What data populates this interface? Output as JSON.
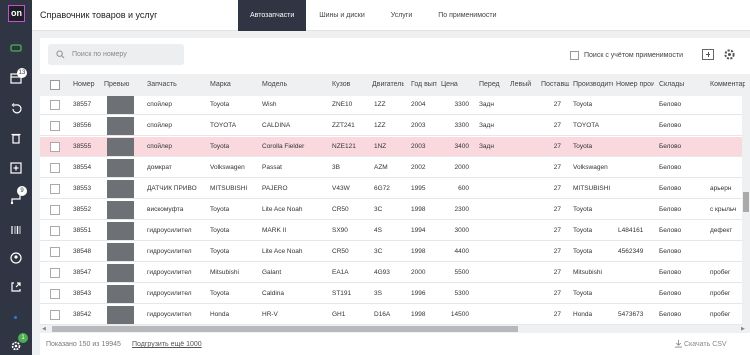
{
  "app": {
    "logo": "on",
    "title": "Справочник товаров и услуг"
  },
  "sidebar": {
    "items": [
      {
        "icon": "inbox-icon",
        "badge": "13"
      },
      {
        "icon": "undo-icon"
      },
      {
        "icon": "trash-icon"
      },
      {
        "icon": "add-box-icon"
      },
      {
        "icon": "route-icon",
        "badge": "9"
      },
      {
        "icon": "user-icon"
      },
      {
        "icon": "export-icon"
      }
    ],
    "settings_badge": "1"
  },
  "tabs": [
    {
      "label": "Автозапчасти",
      "active": true
    },
    {
      "label": "Шины и диски",
      "active": false
    },
    {
      "label": "Услуги",
      "active": false
    },
    {
      "label": "По применимости",
      "active": false
    }
  ],
  "toolbar": {
    "search_placeholder": "Поиск по номеру",
    "applicability_label": "Поиск с учётом применимости"
  },
  "table": {
    "columns": [
      "Номер",
      "Превью",
      "Запчасть",
      "Марка",
      "Модель",
      "Кузов",
      "Двигатель",
      "Год выпуска",
      "Цена",
      "Перед",
      "Левый",
      "Поставщик",
      "Производитель",
      "Номер производителя",
      "Склады",
      "Комментарий"
    ],
    "rows": [
      [
        "38557",
        "",
        "спойлер",
        "Toyota",
        "Wish",
        "ZNE10",
        "1ZZ",
        "2004",
        "3300",
        "Задн",
        "",
        "27",
        "Toyota",
        "",
        "Белово",
        ""
      ],
      [
        "38556",
        "",
        "спойлер",
        "TOYOTA",
        "CALDINA",
        "ZZT241",
        "1ZZ",
        "2003",
        "3300",
        "Задн",
        "",
        "27",
        "TOYOTA",
        "",
        "Белово",
        ""
      ],
      [
        "38555",
        "",
        "спойлер",
        "Toyota",
        "Corolla Fielder",
        "NZE121",
        "1NZ",
        "2003",
        "3400",
        "Задн",
        "",
        "27",
        "Toyota",
        "",
        "Белово",
        ""
      ],
      [
        "38554",
        "",
        "домкрат",
        "Volkswagen",
        "Passat",
        "3B",
        "AZM",
        "2002",
        "2000",
        "",
        "",
        "27",
        "Volkswagen",
        "",
        "Белово",
        ""
      ],
      [
        "38553",
        "",
        "ДАТЧИК ПРИВО",
        "MITSUBISHI",
        "PAJERO",
        "V43W",
        "6G72",
        "1995",
        "600",
        "",
        "",
        "27",
        "MITSUBISHI",
        "",
        "Белово",
        "арьерн"
      ],
      [
        "38552",
        "",
        "вискомуфта",
        "Toyota",
        "Lite Ace Noah",
        "CR50",
        "3C",
        "1998",
        "2300",
        "",
        "",
        "27",
        "Toyota",
        "",
        "Белово",
        "с крыльч"
      ],
      [
        "38551",
        "",
        "гидроусилител",
        "Toyota",
        "MARK II",
        "SX90",
        "4S",
        "1994",
        "3000",
        "",
        "",
        "27",
        "Toyota",
        "L484161",
        "Белово",
        "дефект"
      ],
      [
        "38548",
        "",
        "гидроусилител",
        "Toyota",
        "Lite Ace Noah",
        "CR50",
        "3C",
        "1998",
        "4400",
        "",
        "",
        "27",
        "Toyota",
        "4562349",
        "Белово",
        ""
      ],
      [
        "38547",
        "",
        "гидроусилител",
        "Mitsubishi",
        "Galant",
        "EA1A",
        "4G93",
        "2000",
        "5500",
        "",
        "",
        "27",
        "Mitsubishi",
        "",
        "Белово",
        "пробег"
      ],
      [
        "38543",
        "",
        "гидроусилител",
        "Toyota",
        "Caldina",
        "ST191",
        "3S",
        "1996",
        "5300",
        "",
        "",
        "27",
        "Toyota",
        "",
        "Белово",
        "пробег"
      ],
      [
        "38542",
        "",
        "гидроусилител",
        "Honda",
        "HR-V",
        "GH1",
        "D16A",
        "1998",
        "14500",
        "",
        "",
        "27",
        "Honda",
        "5473673",
        "Белово",
        "пробег"
      ]
    ],
    "highlighted_row": 2
  },
  "footer": {
    "shown": "Показано 150 из 19945",
    "load_more": "Подгрузить ещё 1000",
    "csv": "Скачать CSV"
  },
  "colors": {
    "sidebar": "#2f3542",
    "highlight_row": "#f9d9dd",
    "logo_border": "#c94fd1"
  }
}
